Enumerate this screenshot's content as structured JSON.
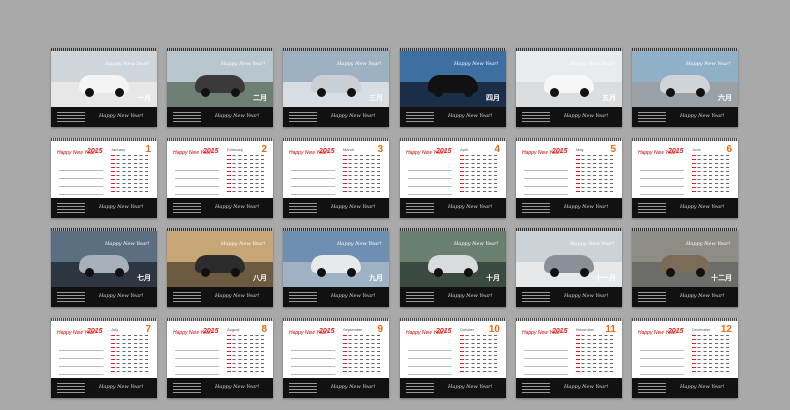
{
  "greeting": "Happy New Year!",
  "year": "2015",
  "photo_cards": [
    {
      "mark": "一月",
      "sky": "#cfd6db",
      "ground": "#e7e7e7",
      "car": "#f4f4f4"
    },
    {
      "mark": "二月",
      "sky": "#b8c6ce",
      "ground": "#6d7f73",
      "car": "#3a3a3a"
    },
    {
      "mark": "三月",
      "sky": "#9eb1c1",
      "ground": "#d7dde2",
      "car": "#c9cfd4"
    },
    {
      "mark": "四月",
      "sky": "#3e6fa1",
      "ground": "#1b2d47",
      "car": "#111111"
    },
    {
      "mark": "五月",
      "sky": "#e9ecef",
      "ground": "#d9dde0",
      "car": "#f7f7f7"
    },
    {
      "mark": "六月",
      "sky": "#8fb0c7",
      "ground": "#9aa1a6",
      "car": "#cfd4d8"
    },
    {
      "mark": "七月",
      "sky": "#5c6f82",
      "ground": "#2c3540",
      "car": "#a6b0ba"
    },
    {
      "mark": "八月",
      "sky": "#c7a675",
      "ground": "#6c5a41",
      "car": "#2c2c2c"
    },
    {
      "mark": "九月",
      "sky": "#6e8fb1",
      "ground": "#9fb2c4",
      "car": "#e7e9ea"
    },
    {
      "mark": "十月",
      "sky": "#6a7f6f",
      "ground": "#3b4a40",
      "car": "#d9dcdd"
    },
    {
      "mark": "十一月",
      "sky": "#cdd2d6",
      "ground": "#e6e8ea",
      "car": "#8a9097"
    },
    {
      "mark": "十二月",
      "sky": "#8d8c85",
      "ground": "#6c6c68",
      "car": "#7a6c58"
    }
  ],
  "calendar_cards": [
    {
      "month": "January",
      "num": "1"
    },
    {
      "month": "February",
      "num": "2"
    },
    {
      "month": "March",
      "num": "3"
    },
    {
      "month": "April",
      "num": "4"
    },
    {
      "month": "May",
      "num": "5"
    },
    {
      "month": "June",
      "num": "6"
    },
    {
      "month": "July",
      "num": "7"
    },
    {
      "month": "August",
      "num": "8"
    },
    {
      "month": "September",
      "num": "9"
    },
    {
      "month": "October",
      "num": "10"
    },
    {
      "month": "November",
      "num": "11"
    },
    {
      "month": "December",
      "num": "12"
    }
  ]
}
